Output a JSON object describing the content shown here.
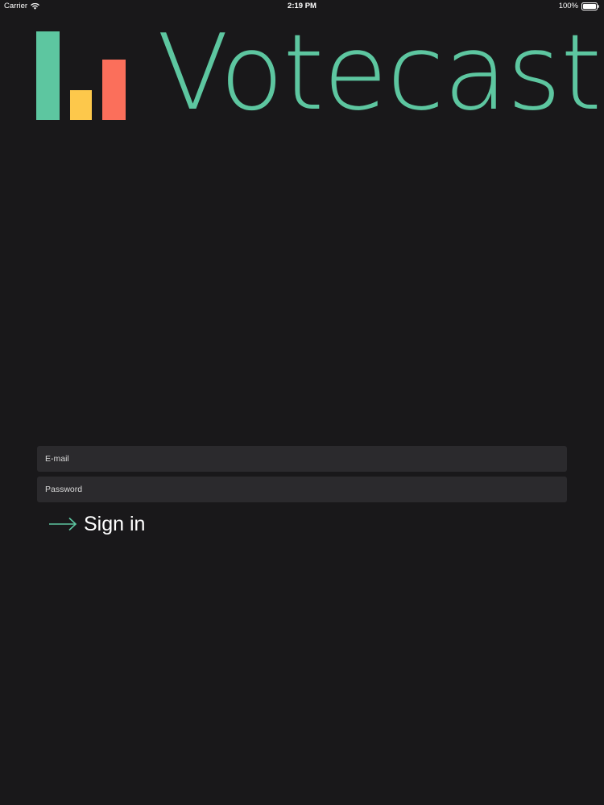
{
  "status_bar": {
    "carrier": "Carrier",
    "time": "2:19 PM",
    "battery": "100%"
  },
  "logo": {
    "wordmark": "Votecast",
    "colors": {
      "green": "#5dc6a0",
      "yellow": "#fdc84b",
      "red": "#fb6f5b"
    }
  },
  "form": {
    "email_placeholder": "E-mail",
    "email_value": "",
    "password_placeholder": "Password",
    "password_value": "",
    "sign_in_label": "Sign in"
  },
  "icons": {
    "wifi": "wifi-icon",
    "battery": "battery-icon",
    "sign_in": "arrow-right-icon"
  },
  "theme": {
    "background": "#19181a",
    "field_background": "#2b2a2d",
    "accent": "#5dc6a0"
  }
}
